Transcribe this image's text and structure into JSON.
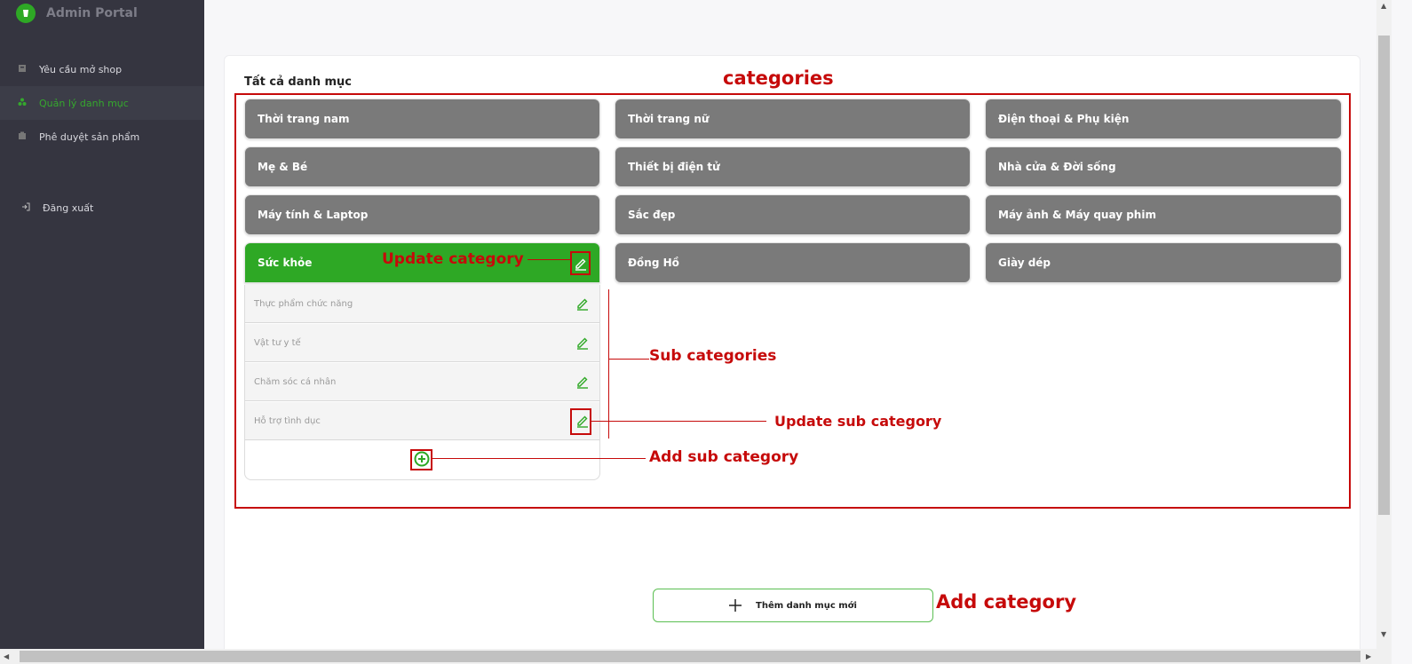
{
  "app": {
    "title": "Admin Portal"
  },
  "sidebar": {
    "items": [
      {
        "label": "Yêu cầu mở shop",
        "icon": "store-icon"
      },
      {
        "label": "Quản lý danh mục",
        "icon": "category-icon",
        "active": true
      },
      {
        "label": "Phê duyệt sản phẩm",
        "icon": "product-icon"
      }
    ],
    "logout_label": "Đăng xuất"
  },
  "main": {
    "section_title": "Tất cả danh mục",
    "categories": [
      "Thời trang nam",
      "Thời trang nữ",
      "Điện thoại & Phụ kiện",
      "Mẹ & Bé",
      "Thiết bị điện tử",
      "Nhà cửa & Đời sống",
      "Máy tính & Laptop",
      "Sắc đẹp",
      "Máy ảnh & Máy quay phim",
      "Sức khỏe",
      "Đồng Hồ",
      "Giày dép"
    ],
    "active_category": "Sức khỏe",
    "sub_categories": [
      "Thực phẩm chức năng",
      "Vật tư y tế",
      "Chăm sóc cá nhân",
      "Hỗ trợ tình dục"
    ],
    "add_category_label": "Thêm danh mục mới"
  },
  "annotations": {
    "categories": "categories",
    "update_category": "Update category",
    "sub_categories": "Sub categories",
    "update_sub_category": "Update sub category",
    "add_sub_category": "Add sub category",
    "add_category": "Add category"
  },
  "colors": {
    "accent": "#2ea825",
    "category_bg": "#7a7a7a",
    "sidebar_bg": "#353540",
    "annotation": "#c60a0a"
  }
}
